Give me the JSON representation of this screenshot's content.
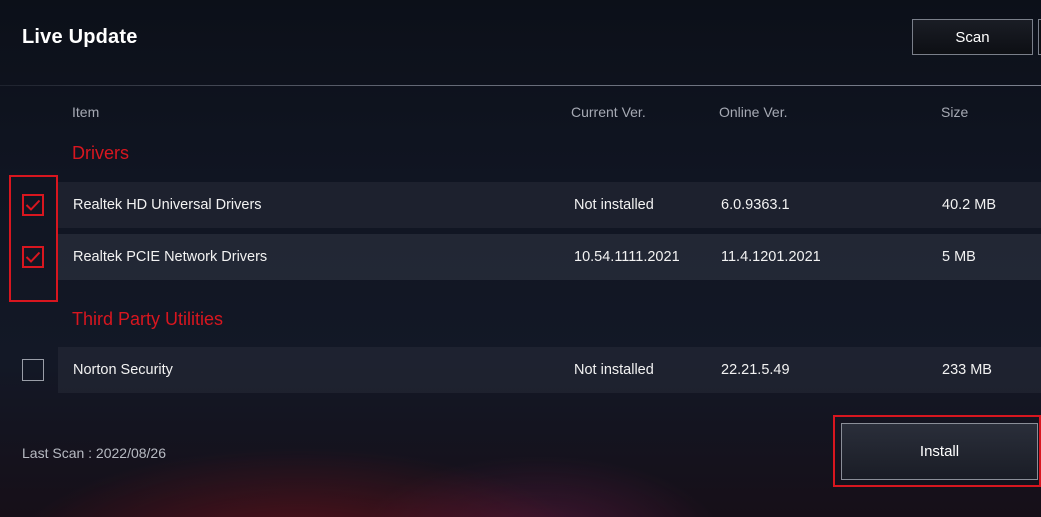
{
  "header": {
    "title": "Live Update",
    "scan_label": "Scan"
  },
  "columns": {
    "item": "Item",
    "current": "Current Ver.",
    "online": "Online Ver.",
    "size": "Size"
  },
  "sections": [
    {
      "title": "Drivers",
      "rows": [
        {
          "name": "Realtek HD Universal Drivers",
          "current": "Not installed",
          "online": "6.0.9363.1",
          "size": "40.2 MB",
          "checked": true
        },
        {
          "name": "Realtek PCIE Network Drivers",
          "current": "10.54.1111.2021",
          "online": "11.4.1201.2021",
          "size": "5 MB",
          "checked": true
        }
      ]
    },
    {
      "title": "Third Party Utilities",
      "rows": [
        {
          "name": "Norton Security",
          "current": "Not installed",
          "online": "22.21.5.49",
          "size": "233 MB",
          "checked": false
        }
      ]
    }
  ],
  "footer": {
    "last_scan": "Last Scan : 2022/08/26",
    "install_label": "Install"
  },
  "colors": {
    "accent": "#d8161f",
    "text": "#ffffff",
    "muted": "#a6aab4"
  },
  "icons": {
    "checkmark": "checkmark-icon"
  }
}
